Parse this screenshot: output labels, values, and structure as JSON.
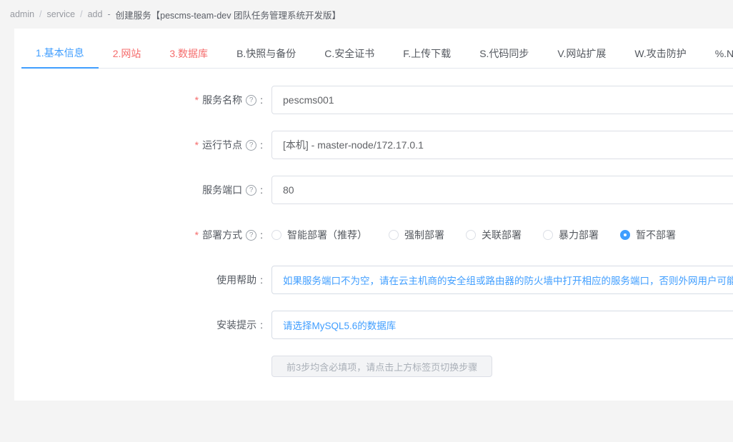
{
  "colors": {
    "primary": "#409EFF",
    "danger": "#F56C6C"
  },
  "breadcrumb": {
    "items": [
      "admin",
      "service",
      "add"
    ],
    "separator": "/",
    "dash": "-",
    "title": "创建服务【pescms-team-dev 团队任务管理系统开发版】"
  },
  "tabs": [
    {
      "label": "1.基本信息",
      "state": "active"
    },
    {
      "label": "2.网站",
      "state": "alert"
    },
    {
      "label": "3.数据库",
      "state": "alert"
    },
    {
      "label": "B.快照与备份",
      "state": "normal"
    },
    {
      "label": "C.安全证书",
      "state": "normal"
    },
    {
      "label": "F.上传下载",
      "state": "normal"
    },
    {
      "label": "S.代码同步",
      "state": "normal"
    },
    {
      "label": "V.网站扩展",
      "state": "normal"
    },
    {
      "label": "W.攻击防护",
      "state": "normal"
    },
    {
      "label": "%.Nginx设置",
      "state": "normal"
    }
  ],
  "form": {
    "required_mark": "*",
    "colon": ":",
    "help_icon_glyph": "?",
    "fields": {
      "service_name": {
        "label": "服务名称",
        "value": "pescms001"
      },
      "run_node": {
        "label": "运行节点",
        "value": "[本机] - master-node/172.17.0.1"
      },
      "service_port": {
        "label": "服务端口",
        "value": "80"
      },
      "deploy": {
        "label": "部署方式",
        "options": [
          "智能部署（推荐）",
          "强制部署",
          "关联部署",
          "暴力部署",
          "暂不部署"
        ],
        "selected": "暂不部署"
      },
      "usage_help": {
        "label": "使用帮助",
        "text": "如果服务端口不为空，请在云主机商的安全组或路由器的防火墙中打开相应的服务端口，否则外网用户可能无法访问"
      },
      "install_tip": {
        "label": "安装提示",
        "text": "请选择MySQL5.6的数据库"
      }
    },
    "footer_button": "前3步均含必填项，请点击上方标签页切换步骤"
  }
}
